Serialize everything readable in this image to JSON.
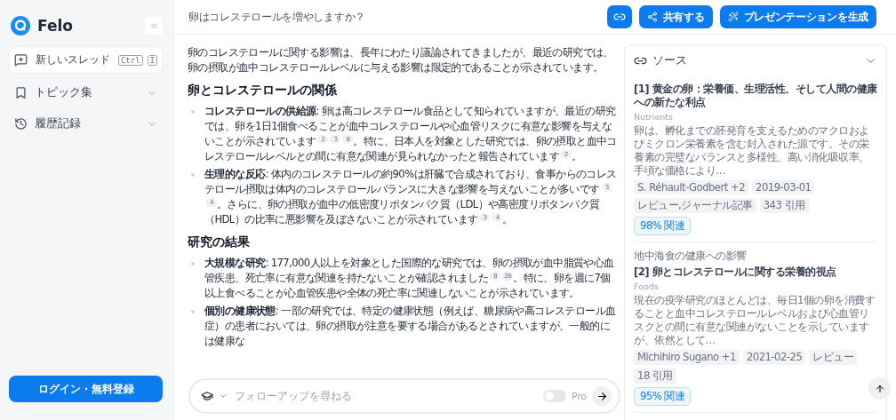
{
  "sidebar": {
    "brand": "Felo",
    "new_thread": {
      "label": "新しいスレッド",
      "keys": [
        "Ctrl",
        "I"
      ]
    },
    "items": [
      {
        "label": "トピック集",
        "expanded": false
      },
      {
        "label": "履歴記録",
        "expanded": false
      }
    ],
    "login_button": "ログイン・無料登録"
  },
  "header": {
    "title": "卵はコレステロールを増やしますか？",
    "buttons": [
      {
        "kind": "link"
      },
      {
        "kind": "share",
        "label": "共有する"
      },
      {
        "kind": "magic",
        "label": "プレゼンテーションを生成"
      }
    ]
  },
  "article": {
    "intro": "卵のコレステロールに関する影響は、長年にわたり議論されてきましたが、最近の研究では、卵の摂取が血中コレステロールレベルに与える影響は限定的であることが示されています。",
    "sections": [
      {
        "heading": "卵とコレステロールの関係",
        "bullets": [
          {
            "term": "コレステロールの供給源",
            "parts": [
              {
                "text": ": 卵は高コレステロール食品として知られていますが、最近の研究では、卵を1日1個食べることが血中コレステロールや心血管リスクに有意な影響を与えないことが示されています",
                "cites": [
                  "2",
                  "3",
                  "8"
                ]
              },
              {
                "text": "。特に、日本人を対象とした研究では、卵の摂取と血中コレステロールレベルとの間に有意な関連が見られなかったと報告されています",
                "cites": [
                  "2"
                ]
              },
              {
                "text": "。"
              }
            ]
          },
          {
            "term": "生理的な反応",
            "parts": [
              {
                "text": ": 体内のコレステロールの約90%は肝臓で合成されており、食事からのコレステロール摂取は体内のコレステロールバランスに大きな影響を与えないことが多いです",
                "cites": [
                  "3",
                  "4"
                ]
              },
              {
                "text": "。さらに、卵の摂取が血中の低密度リポタンパク質（LDL）や高密度リポタンパク質（HDL）の比率に悪影響を及ぼさないことが示されています",
                "cites": [
                  "3",
                  "4"
                ]
              },
              {
                "text": "。"
              }
            ]
          }
        ]
      },
      {
        "heading": "研究の結果",
        "bullets": [
          {
            "term": "大規模な研究",
            "parts": [
              {
                "text": ": 177,000人以上を対象とした国際的な研究では、卵の摂取が血中脂質や心血管疾患、死亡率に有意な関連を持たないことが確認されました",
                "cites": [
                  "8",
                  "26"
                ]
              },
              {
                "text": "。特に、卵を週に7個以上食べることが心血管疾患や全体の死亡率に関連しないことが示されています。"
              }
            ]
          },
          {
            "term": "個別の健康状態",
            "parts": [
              {
                "text": ": 一部の研究では、特定の健康状態（例えば、糖尿病や高コレステロール血症）の患者においては、卵の摂取が注意を要する場合があるとされていますが、一般的には健康な"
              }
            ]
          }
        ]
      }
    ]
  },
  "chat_input": {
    "placeholder": "フォローアップを尋ねる",
    "pro": {
      "label": "Pro",
      "on": false
    }
  },
  "sources": {
    "title": "ソース",
    "items": [
      {
        "title": "[1] 黄金の卵：栄養価、生理活性、そして人間の健康への新たな利点",
        "journal": "Nutrients",
        "snippet": "卵は、孵化までの胚発育を支えるためのマクロおよびミクロン栄養素を含む封入された源です。その栄養素の完璧なバランスと多様性、高い消化吸収率、手頃な価格により…",
        "tags": [
          "S. Réhault-Godbert +2",
          "2019-03-01",
          "レビュー,ジャーナル記事",
          "343 引用"
        ],
        "relevance": "98% 関連"
      },
      {
        "topic": "地中海食の健康への影響",
        "title": "[2] 卵とコレステロールに関する栄養的視点",
        "journal": "Foods",
        "snippet": "現在の疫学研究のほとんどは、毎日1個の卵を消費することと血中コレステロールレベルおよび心血管リスクとの間に有意な関連がないことを示していますが、依然として…",
        "tags": [
          "Michihiro Sugano +1",
          "2021-02-25",
          "レビュー",
          "18 引用"
        ],
        "relevance": "95% 関連"
      }
    ]
  }
}
